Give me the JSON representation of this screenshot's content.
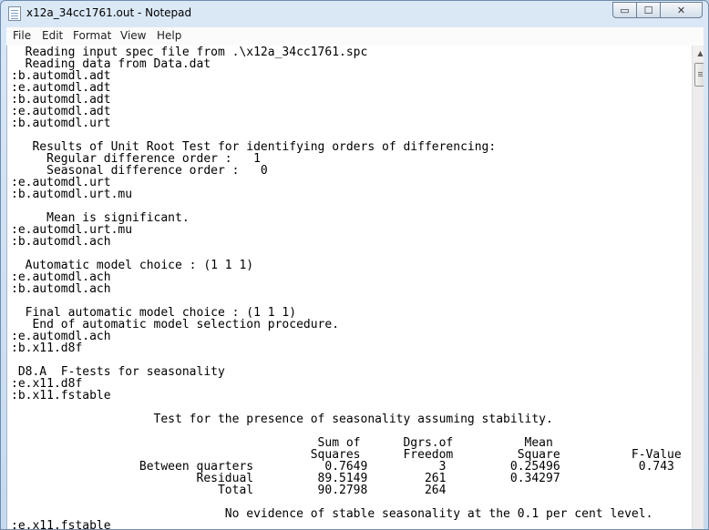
{
  "window": {
    "title": "x12a_34cc1761.out - Notepad"
  },
  "controls": {
    "minimize": "▭",
    "maximize": "☐",
    "close": "✕"
  },
  "menu": {
    "file": "File",
    "edit": "Edit",
    "format": "Format",
    "view": "View",
    "help": "Help"
  },
  "scrollbar": {
    "up_arrow": "▲"
  },
  "icons": {
    "app": "notepad-icon"
  },
  "content": {
    "lines": [
      "  Reading input spec file from .\\x12a_34cc1761.spc",
      "  Reading data from Data.dat",
      ":b.automdl.adt",
      ":e.automdl.adt",
      ":b.automdl.adt",
      ":e.automdl.adt",
      ":b.automdl.urt",
      "",
      "   Results of Unit Root Test for identifying orders of differencing:",
      "     Regular difference order :   1",
      "     Seasonal difference order :   0",
      ":e.automdl.urt",
      ":b.automdl.urt.mu",
      "",
      "     Mean is significant.",
      ":e.automdl.urt.mu",
      ":b.automdl.ach",
      "",
      "  Automatic model choice : (1 1 1)",
      ":e.automdl.ach",
      ":b.automdl.ach",
      "",
      "  Final automatic model choice : (1 1 1)",
      "   End of automatic model selection procedure.",
      ":e.automdl.ach",
      ":b.x11.d8f",
      "",
      " D8.A  F-tests for seasonality",
      ":e.x11.d8f",
      ":b.x11.fstable",
      "",
      "                    Test for the presence of seasonality assuming stability.",
      "",
      "                                           Sum of      Dgrs.of          Mean",
      "                                          Squares      Freedom         Square          F-Value",
      "                  Between quarters          0.7649          3         0.25496           0.743",
      "                          Residual         89.5149        261         0.34297",
      "                             Total         90.2798        264",
      "",
      "                              No evidence of stable seasonality at the 0.1 per cent level.",
      ":e.x11.fstable"
    ]
  }
}
